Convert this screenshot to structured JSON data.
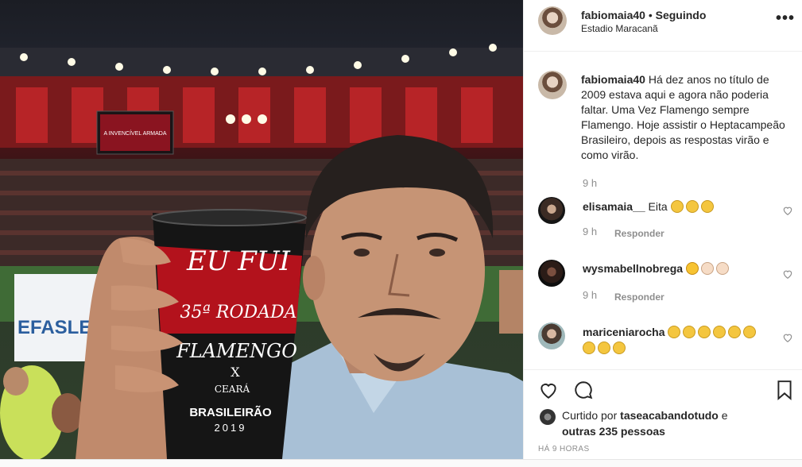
{
  "post": {
    "username": "fabiomaia40",
    "separator": "•",
    "follow_state": "Seguindo",
    "location": "Estadio Maracanã",
    "caption": "Há dez anos no título de 2009 estava aqui e agora não poderia faltar. Uma Vez Flamengo sempre Flamengo. Hoje assistir o Heptacampeão Brasileiro, depois as respostas virão e como virão.",
    "caption_time": "9 h"
  },
  "comments": [
    {
      "username": "elisamaia__",
      "text": "Eita",
      "emoji": [
        "clap",
        "clap",
        "clap"
      ],
      "time": "9 h",
      "reply": "Responder"
    },
    {
      "username": "wysmabellnobrega",
      "text": "",
      "emoji": [
        "wink",
        "clap-light",
        "clap-light"
      ],
      "time": "9 h",
      "reply": "Responder"
    },
    {
      "username": "mariceniarocha",
      "text": "",
      "emoji": [
        "clap",
        "clap",
        "clap",
        "clap",
        "clap",
        "clap",
        "clap",
        "clap",
        "clap"
      ]
    }
  ],
  "likes": {
    "prefix": "Curtido por",
    "user": "taseacabandotudo",
    "conj": "e",
    "others": "outras 235 pessoas"
  },
  "posted_ago": "HÁ 9 HORAS",
  "photo": {
    "cup_line1": "EU FUI",
    "cup_line2": "35ª RODADA",
    "cup_line3": "FLAMENGO",
    "cup_line4": "X",
    "cup_line5": "CEARÁ",
    "cup_brand": "BRASILEIRÃO",
    "cup_year": "2019",
    "banner_text": "EFASLEIR",
    "screen_text": "A INVENCÍVEL ARMADA"
  },
  "icons": {
    "more": "more-options-icon",
    "like": "heart-icon",
    "comment": "comment-icon",
    "save": "bookmark-icon"
  },
  "colors": {
    "text": "#262626",
    "muted": "#8e8e8e",
    "border": "#efefef",
    "flamengo_red": "#b3121c"
  }
}
